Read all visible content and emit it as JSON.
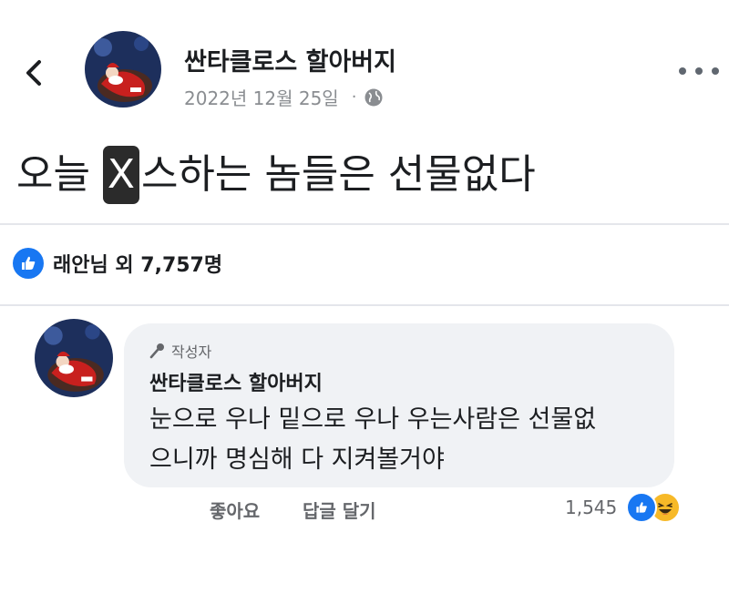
{
  "post": {
    "author": "싼타클로스 할아버지",
    "date": "2022년 12월 25일",
    "dot": "·",
    "text_censored": "X",
    "text_rest": "스하는 놈들은 선물없다",
    "text_prefix": "오늘 ",
    "reactions_label": "래안님 외 7,757명"
  },
  "comment": {
    "author_tag": "작성자",
    "author": "싼타클로스 할아버지",
    "line1": "눈으로 우나 밑으로 우나 우는사람은 선물없",
    "line2": "으니까 명심해 다 지켜볼거야",
    "like_label": "좋아요",
    "reply_label": "답글 달기",
    "reaction_count": "1,545"
  },
  "icons": {
    "back": "chevron-left-icon",
    "more": "more-horizontal-icon",
    "privacy": "globe-icon",
    "like": "thumbs-up-icon",
    "haha": "laughing-face-icon",
    "author_badge": "microphone-icon"
  },
  "colors": {
    "like_blue": "#1877f2",
    "haha_yellow": "#f7b928",
    "bubble_bg": "#f0f2f5",
    "meta_gray": "#8a8d91"
  }
}
